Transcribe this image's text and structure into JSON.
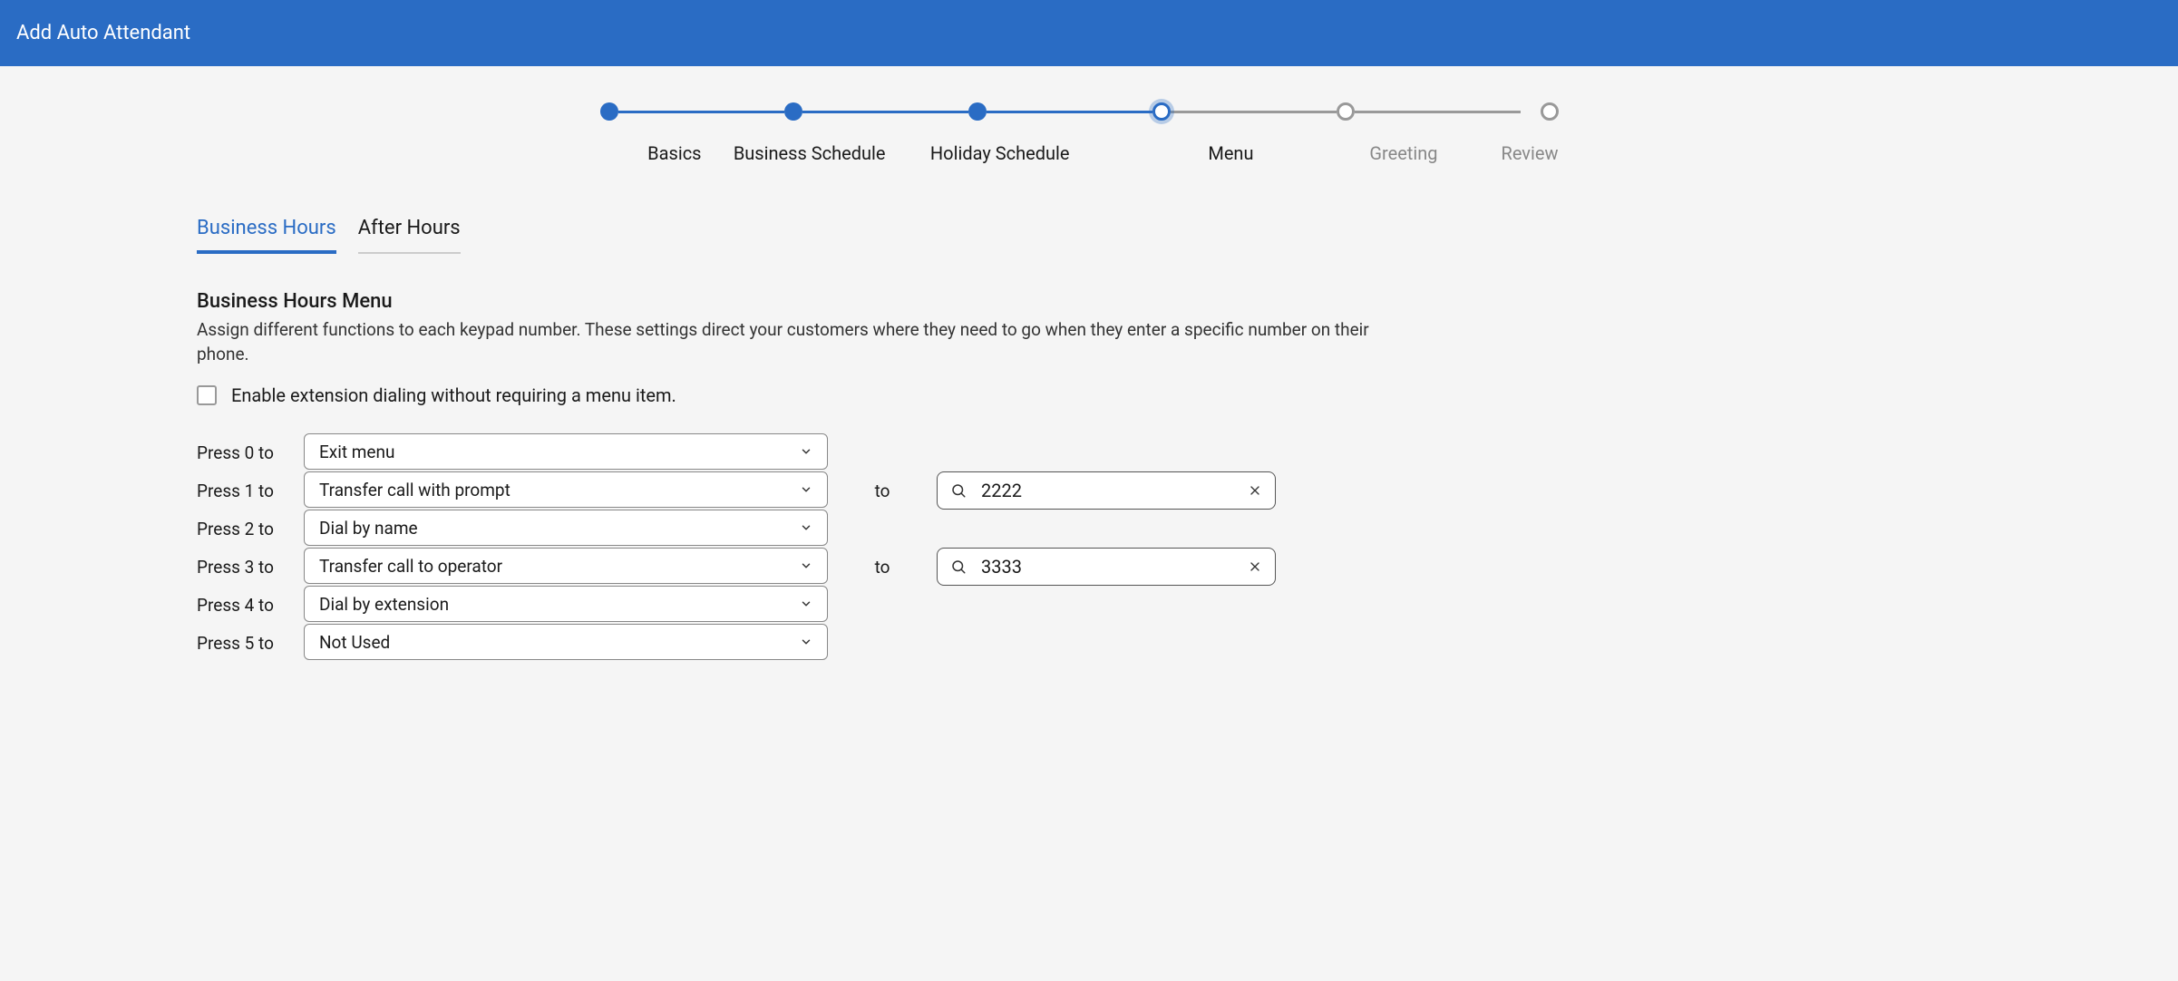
{
  "header": {
    "title": "Add Auto Attendant"
  },
  "stepper": {
    "steps": [
      {
        "label": "Basics",
        "state": "done"
      },
      {
        "label": "Business Schedule",
        "state": "done"
      },
      {
        "label": "Holiday Schedule",
        "state": "done"
      },
      {
        "label": "Menu",
        "state": "current"
      },
      {
        "label": "Greeting",
        "state": "pending"
      },
      {
        "label": "Review",
        "state": "pending"
      }
    ]
  },
  "tabs": [
    {
      "label": "Business Hours",
      "active": true
    },
    {
      "label": "After Hours",
      "active": false
    }
  ],
  "section": {
    "title": "Business Hours Menu",
    "description": "Assign different functions to each keypad number. These settings direct your customers where they need to go when they enter a specific number on their phone."
  },
  "checkbox": {
    "label": "Enable extension dialing without requiring a menu item.",
    "checked": false
  },
  "menuRows": [
    {
      "label": "Press 0 to",
      "action": "Exit menu",
      "hasTarget": false
    },
    {
      "label": "Press 1 to",
      "action": "Transfer call with prompt",
      "hasTarget": true,
      "toLabel": "to",
      "target": "2222"
    },
    {
      "label": "Press 2 to",
      "action": "Dial by name",
      "hasTarget": false
    },
    {
      "label": "Press 3 to",
      "action": "Transfer call to operator",
      "hasTarget": true,
      "toLabel": "to",
      "target": "3333"
    },
    {
      "label": "Press 4 to",
      "action": "Dial by extension",
      "hasTarget": false
    },
    {
      "label": "Press 5 to",
      "action": "Not Used",
      "hasTarget": false
    }
  ]
}
